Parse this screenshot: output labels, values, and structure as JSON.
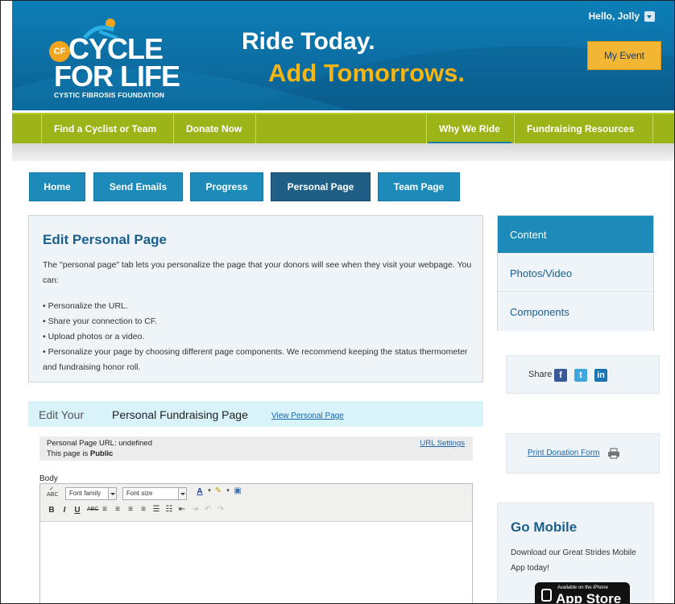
{
  "header": {
    "logo_line1": "CYCLE",
    "logo_line2": "FOR LIFE",
    "logo_badge": "CF",
    "logo_line3": "CYSTIC FIBROSIS FOUNDATION",
    "tagline1": "Ride Today.",
    "tagline2": "Add Tomorrows.",
    "greeting": "Hello, Jolly",
    "my_event": "My Event"
  },
  "nav": {
    "items": [
      "Find a Cyclist or Team",
      "Donate Now",
      "Why We Ride",
      "Fundraising Resources"
    ]
  },
  "tabs": [
    "Home",
    "Send Emails",
    "Progress",
    "Personal Page",
    "Team Page"
  ],
  "intro": {
    "title": "Edit Personal Page",
    "paragraph": "The \"personal page\" tab lets you personalize the page that your donors will see when they visit your webpage. You can:",
    "bullets": [
      "Personalize the URL.",
      "Share your connection to CF.",
      "Upload photos or a video.",
      "Personalize your page by choosing different page components. We recommend keeping the status thermometer and fundraising honor roll."
    ]
  },
  "side_nav": [
    "Content",
    "Photos/Video",
    "Components"
  ],
  "share": {
    "label": "Share"
  },
  "print": {
    "link": "Print Donation Form"
  },
  "mobile": {
    "title": "Go Mobile",
    "text": "Download our Great Strides Mobile App today!",
    "badge_small": "Available on the iPhone",
    "badge_big": "App Store"
  },
  "edit": {
    "heading_prefix": "Edit Your",
    "heading_main": "Personal Fundraising Page",
    "view_link": "View Personal Page",
    "url_line": "Personal Page URL:  undefined",
    "status_prefix": "This page is",
    "status_value": "Public",
    "url_settings": "URL Settings",
    "body_label": "Body",
    "font_family": "Font family",
    "font_size": "Font size"
  }
}
